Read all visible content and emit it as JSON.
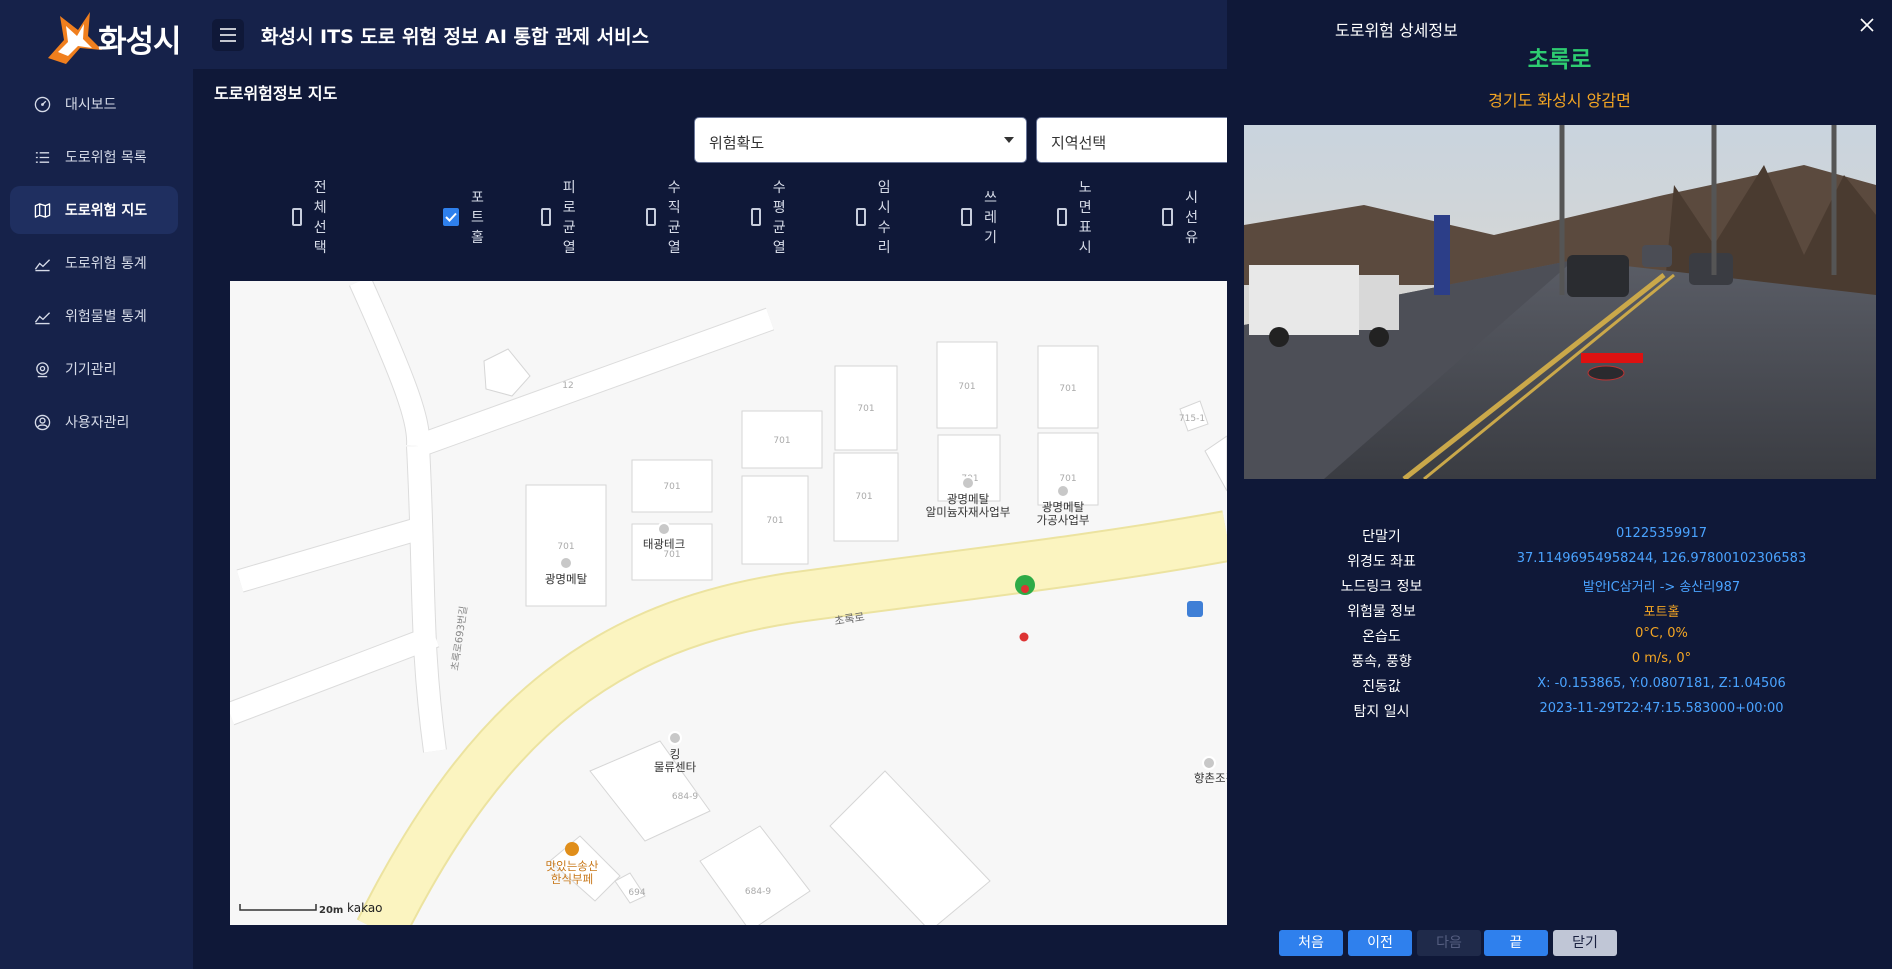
{
  "brand": {
    "logo_text": "화성시"
  },
  "header": {
    "title": "화성시 ITS 도로 위험 정보 AI 통합 관제 서비스"
  },
  "sidebar": {
    "items": [
      {
        "label": "대시보드",
        "icon": "dashboard-icon",
        "active": false
      },
      {
        "label": "도로위험 목록",
        "icon": "list-icon",
        "active": false
      },
      {
        "label": "도로위험 지도",
        "icon": "map-icon",
        "active": true
      },
      {
        "label": "도로위험 통계",
        "icon": "chart-icon",
        "active": false
      },
      {
        "label": "위험물별 통계",
        "icon": "chart-icon",
        "active": false
      },
      {
        "label": "기기관리",
        "icon": "device-icon",
        "active": false
      },
      {
        "label": "사용자관리",
        "icon": "user-icon",
        "active": false
      }
    ]
  },
  "main": {
    "title": "도로위험정보 지도",
    "filters": {
      "risk_placeholder": "위험확도",
      "region_placeholder": "지역선택"
    },
    "checkboxes": [
      {
        "label": "전체선택",
        "checked": false
      },
      {
        "label": "포트홀",
        "checked": true
      },
      {
        "label": "피로균열",
        "checked": false
      },
      {
        "label": "수직균열",
        "checked": false
      },
      {
        "label": "수평균열",
        "checked": false
      },
      {
        "label": "임시수리",
        "checked": false
      },
      {
        "label": "쓰레기",
        "checked": false
      },
      {
        "label": "노면표시",
        "checked": false
      },
      {
        "label": "시선유",
        "checked": false
      }
    ]
  },
  "map": {
    "road_label": "초록로",
    "side_road_label": "초록로693번길",
    "scale_label": "20m",
    "provider": "kakao",
    "places": [
      {
        "name": "광명메탈"
      },
      {
        "name": "태광테크"
      },
      {
        "name": "광명메탈",
        "sub": "알미늄자재사업부"
      },
      {
        "name": "광명메탈",
        "sub": "가공사업부"
      },
      {
        "name": "킹",
        "sub": "물류센타"
      },
      {
        "name": "맛있는송산",
        "sub": "한식부페"
      },
      {
        "name": "향촌조경"
      }
    ],
    "lot_numbers": [
      "12",
      "701",
      "701",
      "701",
      "701",
      "701",
      "701",
      "701",
      "701",
      "701",
      "701",
      "701",
      "715-1",
      "684-9",
      "684-9",
      "694"
    ]
  },
  "detail": {
    "title": "도로위험 상세정보",
    "road": "초록로",
    "region": "경기도 화성시 양감면",
    "rows": [
      {
        "label": "단말기",
        "value": "01225359917",
        "color": "blue"
      },
      {
        "label": "위경도 좌표",
        "value": "37.11496954958244, 126.97800102306583",
        "color": "blue"
      },
      {
        "label": "노드링크 정보",
        "value": "발안IC삼거리 -> 송산리987",
        "color": "blue"
      },
      {
        "label": "위험물 정보",
        "value": "포트홀",
        "color": "orange"
      },
      {
        "label": "온습도",
        "value": "0°C, 0%",
        "color": "orange"
      },
      {
        "label": "풍속, 풍향",
        "value": "0 m/s, 0°",
        "color": "orange"
      },
      {
        "label": "진동값",
        "value": "X: -0.153865, Y:0.0807181, Z:1.04506",
        "color": "blue"
      },
      {
        "label": "탐지 일시",
        "value": "2023-11-29T22:47:15.583000+00:00",
        "color": "blue"
      }
    ],
    "buttons": {
      "first": "처음",
      "prev": "이전",
      "next": "다음",
      "last": "끝",
      "close": "닫기"
    }
  }
}
